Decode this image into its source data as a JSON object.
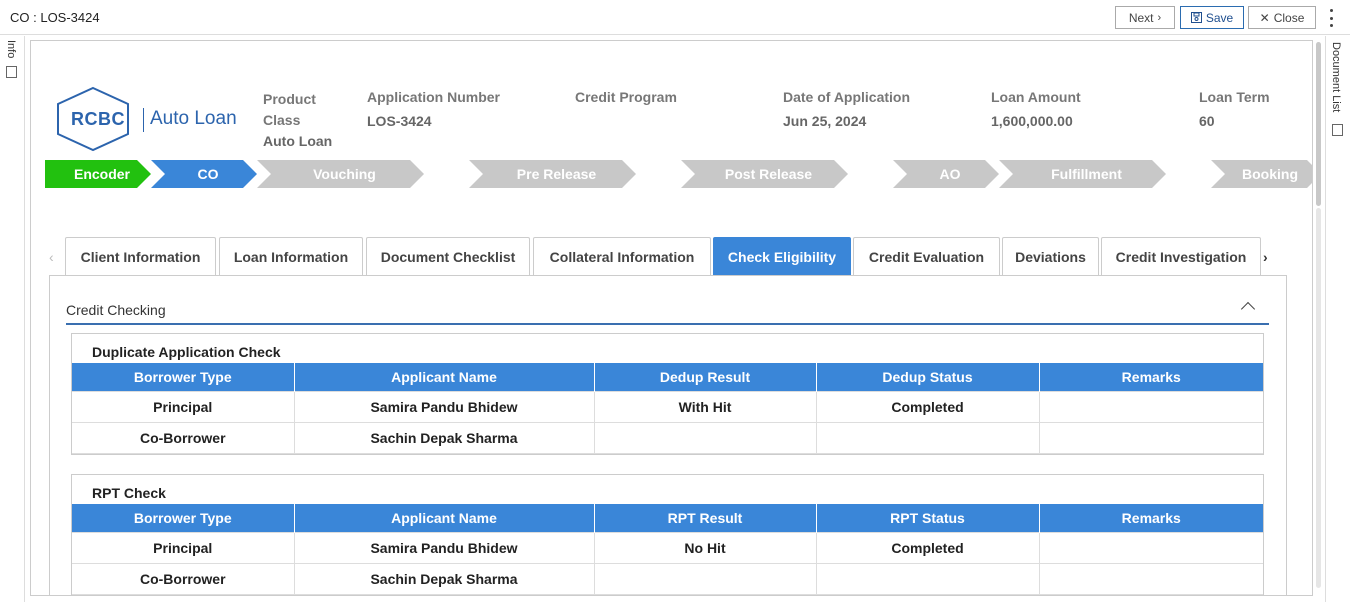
{
  "window": {
    "title": "CO : LOS-3424"
  },
  "toolbar": {
    "next_label": "Next",
    "save_label": "Save",
    "close_label": "Close"
  },
  "left_rail": {
    "label": "Info"
  },
  "right_rail": {
    "label": "Document List"
  },
  "logo": {
    "brand": "RCBC",
    "product": "Auto Loan"
  },
  "header": {
    "product_class_label": "Product Class",
    "product_class_value": "Auto Loan",
    "application_number_label": "Application Number",
    "application_number_value": "LOS-3424",
    "credit_program_label": "Credit Program",
    "credit_program_value": "",
    "date_label": "Date of Application",
    "date_value": "Jun 25, 2024",
    "loan_amount_label": "Loan Amount",
    "loan_amount_value": "1,600,000.00",
    "loan_term_label": "Loan Term",
    "loan_term_value": "60"
  },
  "stages": [
    {
      "label": "Encoder",
      "status": "done",
      "color": "#22c10f"
    },
    {
      "label": "CO",
      "status": "current",
      "color": "#3a86d8"
    },
    {
      "label": "Vouching",
      "status": "pending",
      "color": "#c8c8c8"
    },
    {
      "label": "Pre Release",
      "status": "pending",
      "color": "#c8c8c8"
    },
    {
      "label": "Post Release",
      "status": "pending",
      "color": "#c8c8c8"
    },
    {
      "label": "AO",
      "status": "pending",
      "color": "#c8c8c8"
    },
    {
      "label": "Fulfillment",
      "status": "pending",
      "color": "#c8c8c8"
    },
    {
      "label": "Booking",
      "status": "pending",
      "color": "#c8c8c8"
    }
  ],
  "tabs": [
    {
      "label": "Client Information"
    },
    {
      "label": "Loan Information"
    },
    {
      "label": "Document Checklist"
    },
    {
      "label": "Collateral Information"
    },
    {
      "label": "Check Eligibility",
      "active": true
    },
    {
      "label": "Credit Evaluation"
    },
    {
      "label": "Deviations"
    },
    {
      "label": "Credit Investigation"
    }
  ],
  "section": {
    "title": "Credit Checking"
  },
  "dedup": {
    "title": "Duplicate Application Check",
    "columns": [
      "Borrower Type",
      "Applicant Name",
      "Dedup Result",
      "Dedup Status",
      "Remarks"
    ],
    "rows": [
      [
        "Principal",
        "Samira Pandu Bhidew",
        "With Hit",
        "Completed",
        ""
      ],
      [
        "Co-Borrower",
        "Sachin Depak Sharma",
        "",
        "",
        ""
      ]
    ]
  },
  "rpt": {
    "title": "RPT Check",
    "columns": [
      "Borrower Type",
      "Applicant Name",
      "RPT Result",
      "RPT Status",
      "Remarks"
    ],
    "rows": [
      [
        "Principal",
        "Samira Pandu Bhidew",
        "No Hit",
        "Completed",
        ""
      ],
      [
        "Co-Borrower",
        "Sachin Depak Sharma",
        "",
        "",
        ""
      ]
    ]
  },
  "colors": {
    "accent": "#3a86d8",
    "done": "#22c10f",
    "pending": "#c8c8c8",
    "brand": "#2c64ad"
  }
}
